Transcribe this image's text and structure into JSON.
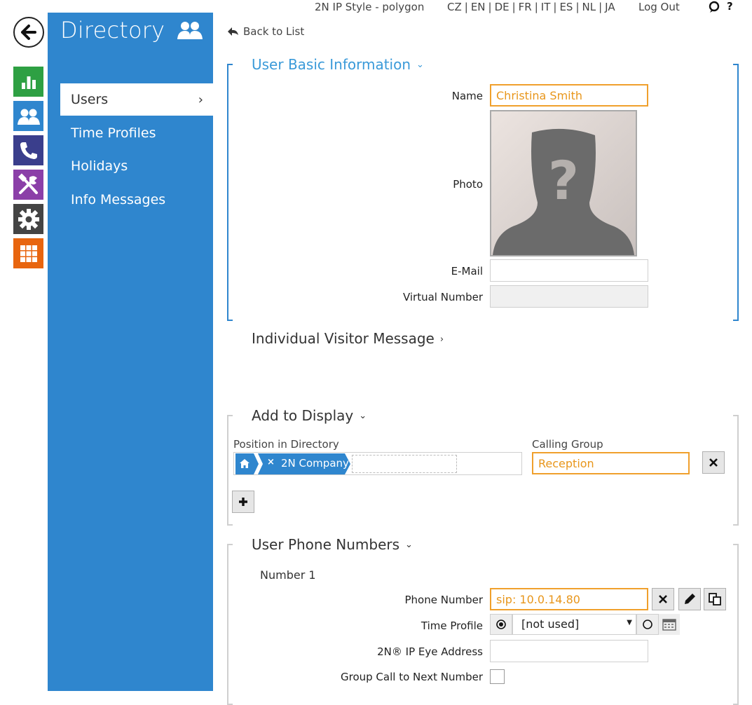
{
  "topbar": {
    "device": "2N IP Style - polygon",
    "languages": [
      "CZ",
      "EN",
      "DE",
      "FR",
      "IT",
      "ES",
      "NL",
      "JA"
    ],
    "logout": "Log Out",
    "help": "?"
  },
  "rail": {
    "tiles": [
      {
        "name": "status-icon",
        "color": "#2ea043"
      },
      {
        "name": "directory-icon",
        "color": "#2f86ce"
      },
      {
        "name": "phone-icon",
        "color": "#3a3e8c"
      },
      {
        "name": "tools-icon",
        "color": "#8b3fa8"
      },
      {
        "name": "settings-icon",
        "color": "#444444"
      },
      {
        "name": "apps-icon",
        "color": "#e8650f"
      }
    ]
  },
  "sidebar": {
    "title": "Directory",
    "items": [
      {
        "label": "Users",
        "active": true
      },
      {
        "label": "Time Profiles"
      },
      {
        "label": "Holidays"
      },
      {
        "label": "Info Messages"
      }
    ]
  },
  "main": {
    "back": "Back to List",
    "basic": {
      "title": "User Basic Information",
      "name_label": "Name",
      "name_value": "Christina Smith",
      "photo_label": "Photo",
      "email_label": "E-Mail",
      "email_value": "",
      "virtual_label": "Virtual Number",
      "virtual_value": ""
    },
    "visitor": {
      "title": "Individual Visitor Message"
    },
    "display": {
      "title": "Add to Display",
      "position_label": "Position in Directory",
      "crumb": "2N Company",
      "group_label": "Calling Group",
      "group_value": "Reception"
    },
    "phones": {
      "title": "User Phone Numbers",
      "number_heading": "Number 1",
      "phone_label": "Phone Number",
      "phone_value": "sip: 10.0.14.80",
      "profile_label": "Time Profile",
      "profile_value": "[not used]",
      "eye_label": "2N® IP Eye Address",
      "eye_value": "",
      "group_call_label": "Group Call to Next Number"
    }
  },
  "colors": {
    "accent": "#2f86ce",
    "highlight": "#f0a02c"
  }
}
